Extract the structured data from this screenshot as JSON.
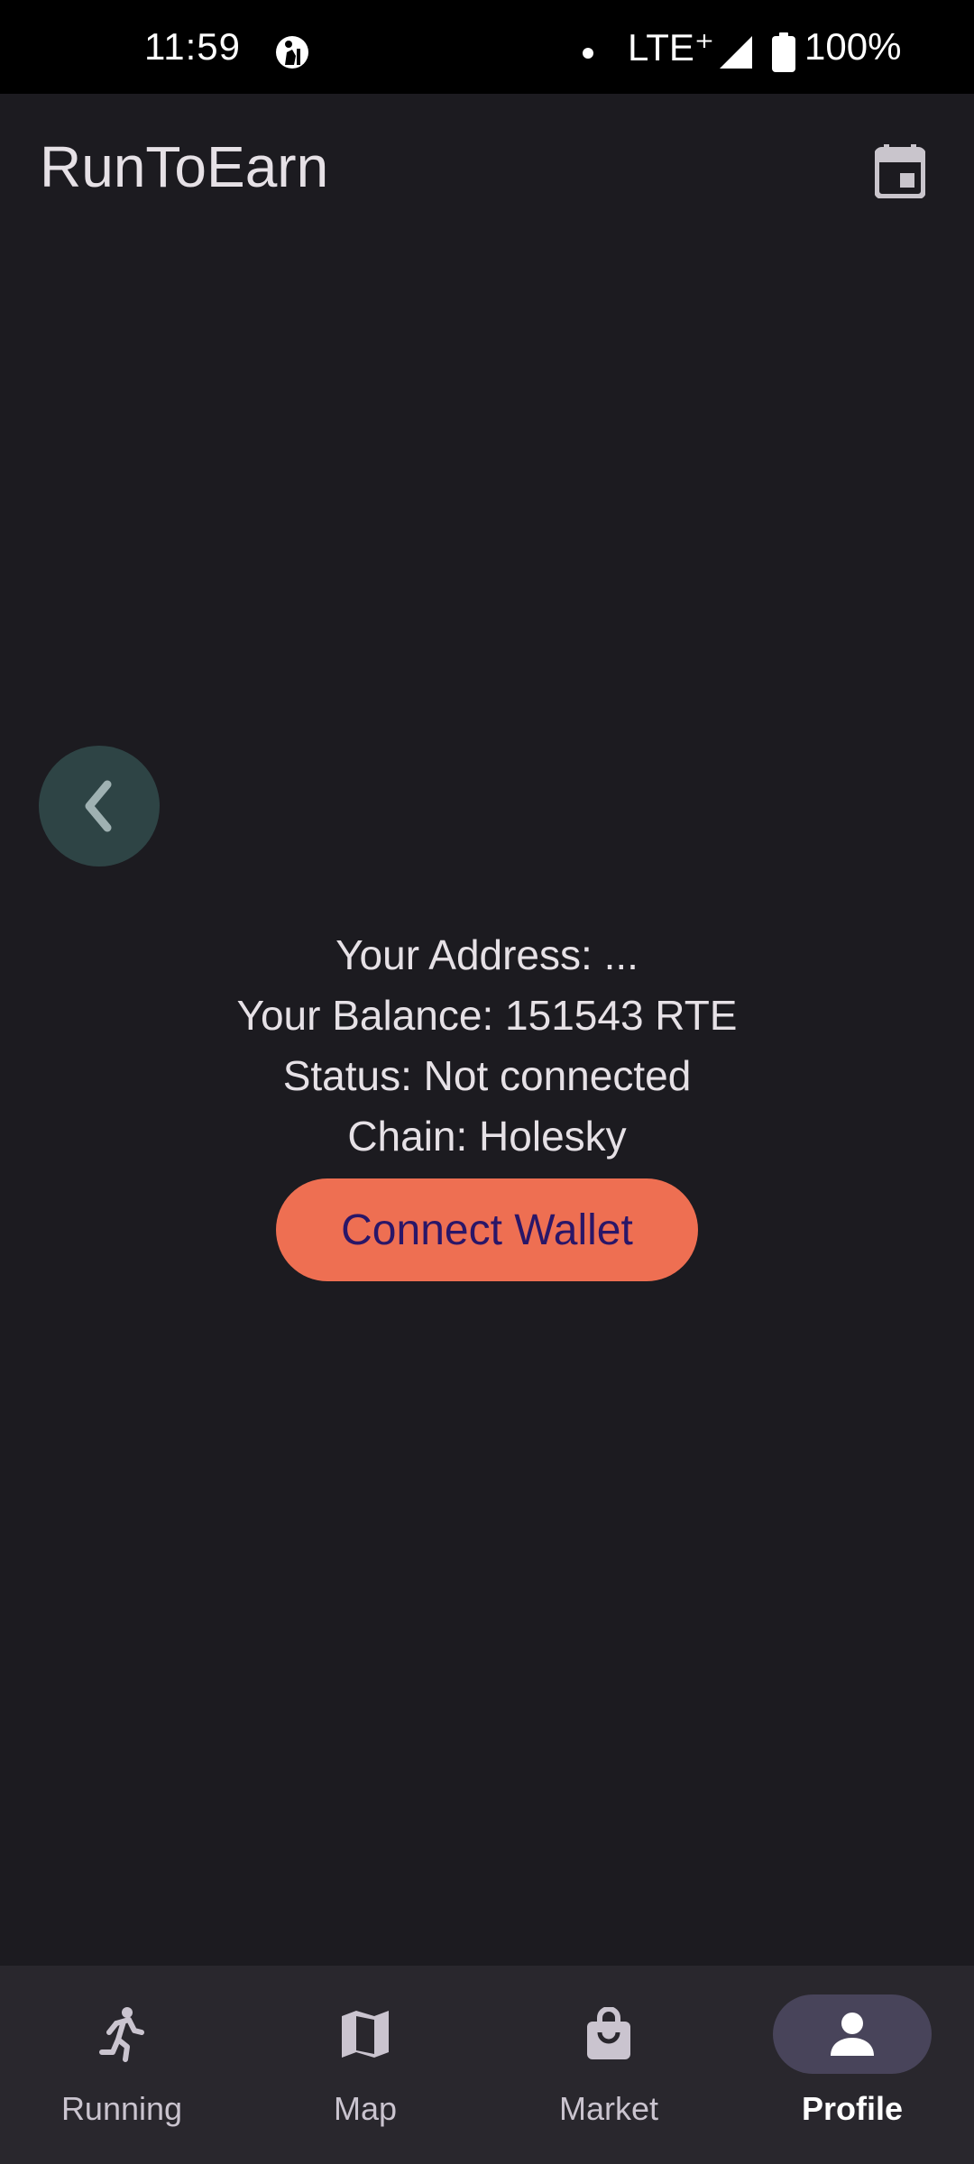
{
  "status_bar": {
    "time": "11:59",
    "network": "LTE⁺",
    "battery": "100%"
  },
  "app_bar": {
    "title": "RunToEarn",
    "calendar_icon": "calendar-icon"
  },
  "back_button": {
    "icon": "chevron-left-icon"
  },
  "profile": {
    "address_line": "Your Address: ...",
    "balance_line": "Your Balance: 151543 RTE",
    "status_line": "Status: Not connected",
    "chain_line": "Chain: Holesky",
    "connect_label": "Connect Wallet"
  },
  "bottom_nav": {
    "items": [
      {
        "label": "Running",
        "icon": "running-icon"
      },
      {
        "label": "Map",
        "icon": "map-icon"
      },
      {
        "label": "Market",
        "icon": "shopping-bag-icon"
      },
      {
        "label": "Profile",
        "icon": "person-icon"
      }
    ],
    "active": "Profile"
  },
  "colors": {
    "background": "#1c1b20",
    "accent_button": "#ee6f52",
    "button_text": "#2a1668",
    "nav_background": "#29272d",
    "nav_active_pill": "#48445a",
    "fab_background": "#2e4445"
  }
}
